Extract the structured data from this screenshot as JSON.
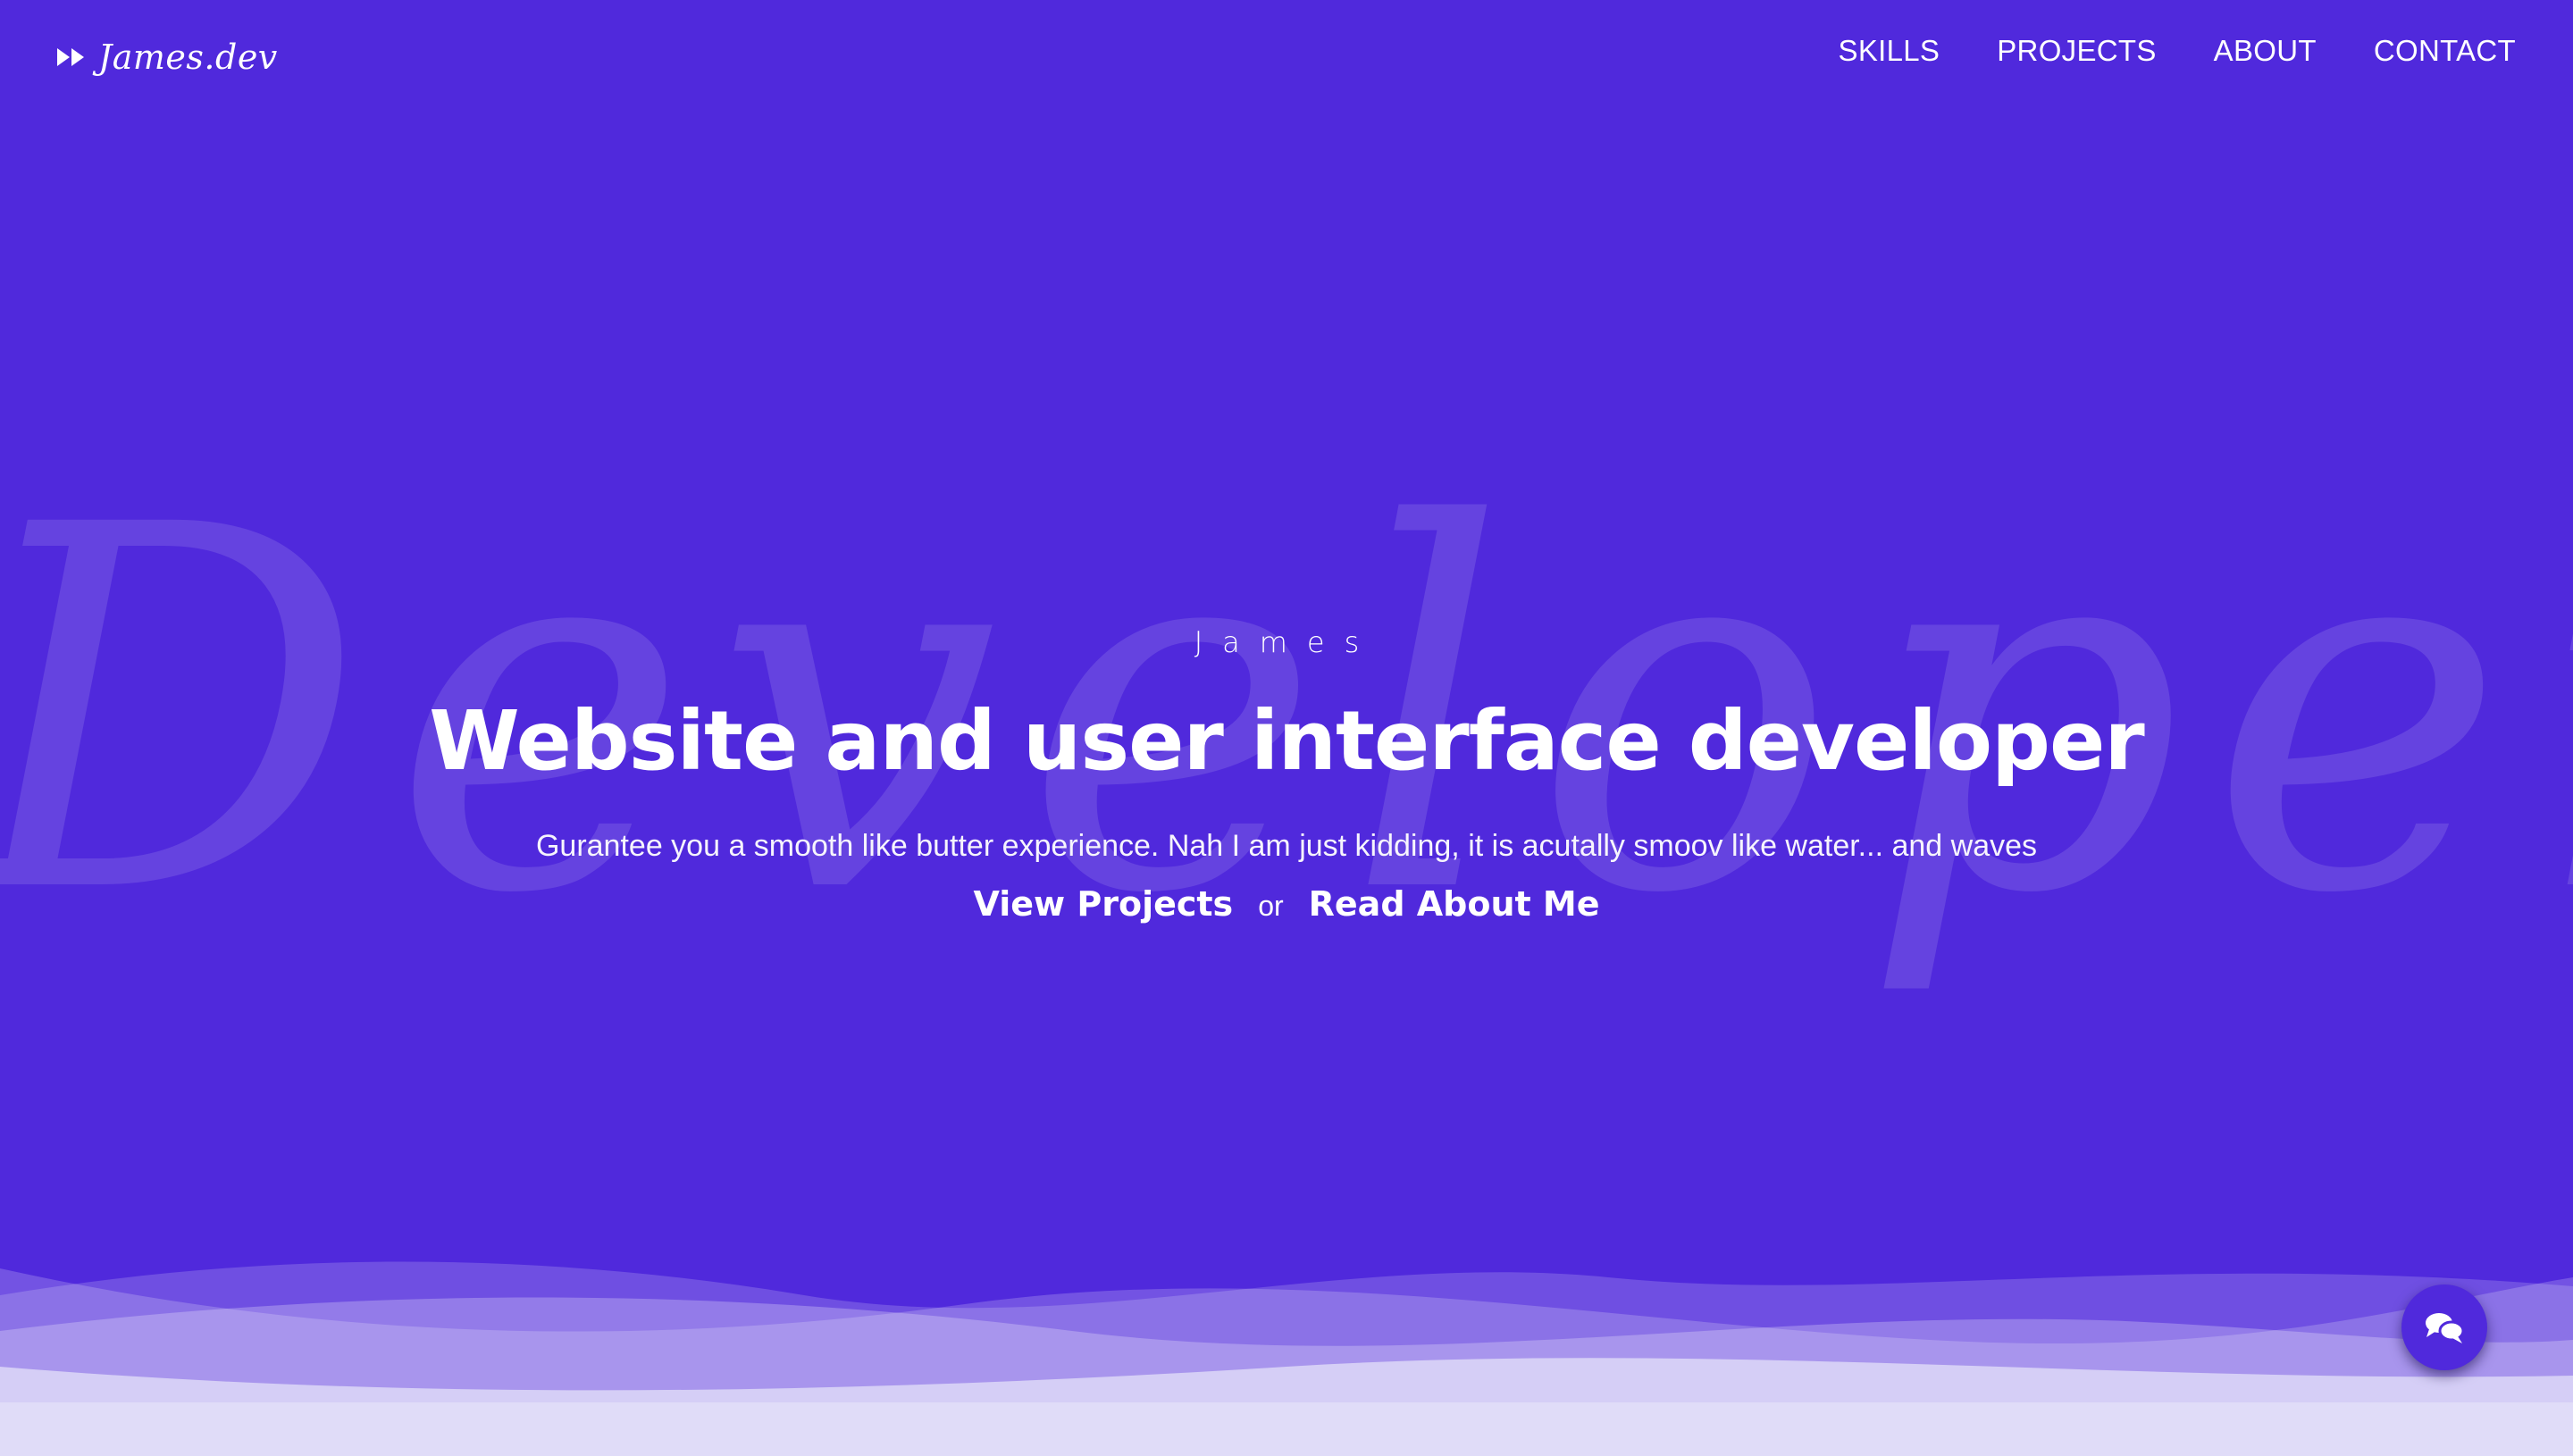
{
  "header": {
    "logo_text": "James.dev",
    "logo_icon": "fast-forward-icon",
    "nav": [
      "SKILLS",
      "PROJECTS",
      "ABOUT",
      "CONTACT"
    ]
  },
  "background": {
    "script_word": "Developer"
  },
  "hero": {
    "name": "James",
    "title": "Website and user interface developer",
    "subtitle": "Gurantee you a smooth like butter experience. Nah I am just kidding, it is acutally smoov like water... and waves",
    "primary_link": "View Projects",
    "separator": "or",
    "secondary_link": "Read About Me"
  },
  "chat": {
    "icon": "chat-bubbles-icon"
  },
  "colors": {
    "background": "#5029dc",
    "text": "#ffffff",
    "wave_light": "#e0dcf8"
  }
}
